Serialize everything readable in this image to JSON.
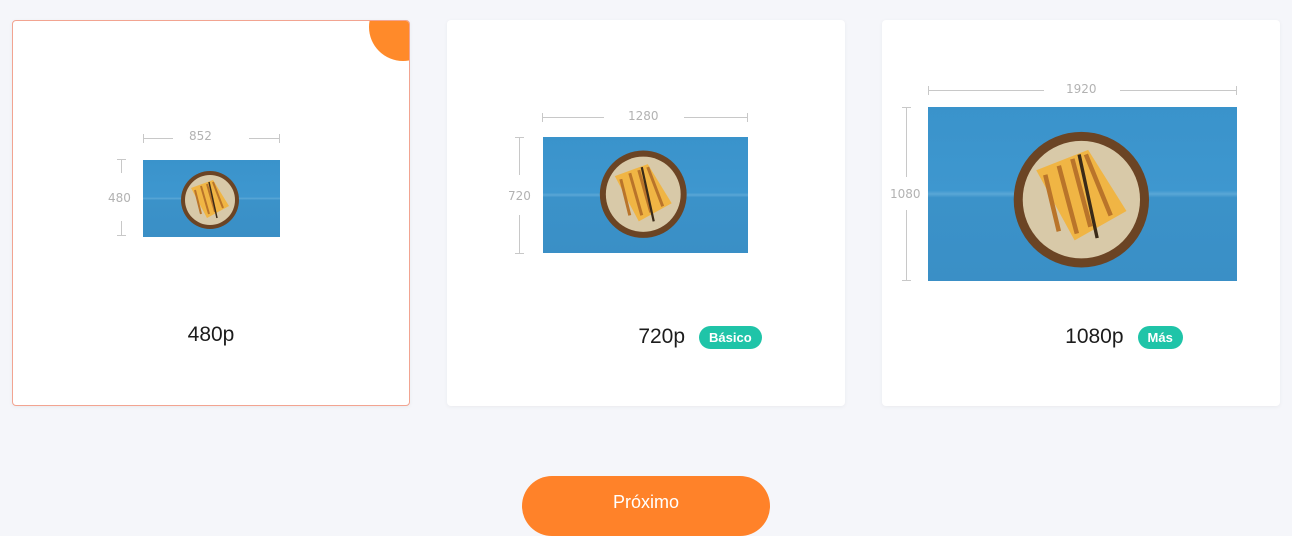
{
  "colors": {
    "accent": "#ff8229",
    "selected_border": "#f2a491",
    "badge": "#1fc4a8",
    "background": "#f5f6fa"
  },
  "options": [
    {
      "resolution_label": "480p",
      "width_text": "852",
      "height_text": "480",
      "badge": "",
      "selected": true
    },
    {
      "resolution_label": "720p",
      "width_text": "1280",
      "height_text": "720",
      "badge": "Básico",
      "selected": false
    },
    {
      "resolution_label": "1080p",
      "width_text": "1920",
      "height_text": "1080",
      "badge": "Más",
      "selected": false
    }
  ],
  "icons": {
    "selected_check": "check-icon",
    "preview": "sandwich-image"
  },
  "next_button": {
    "label": "Próximo"
  }
}
